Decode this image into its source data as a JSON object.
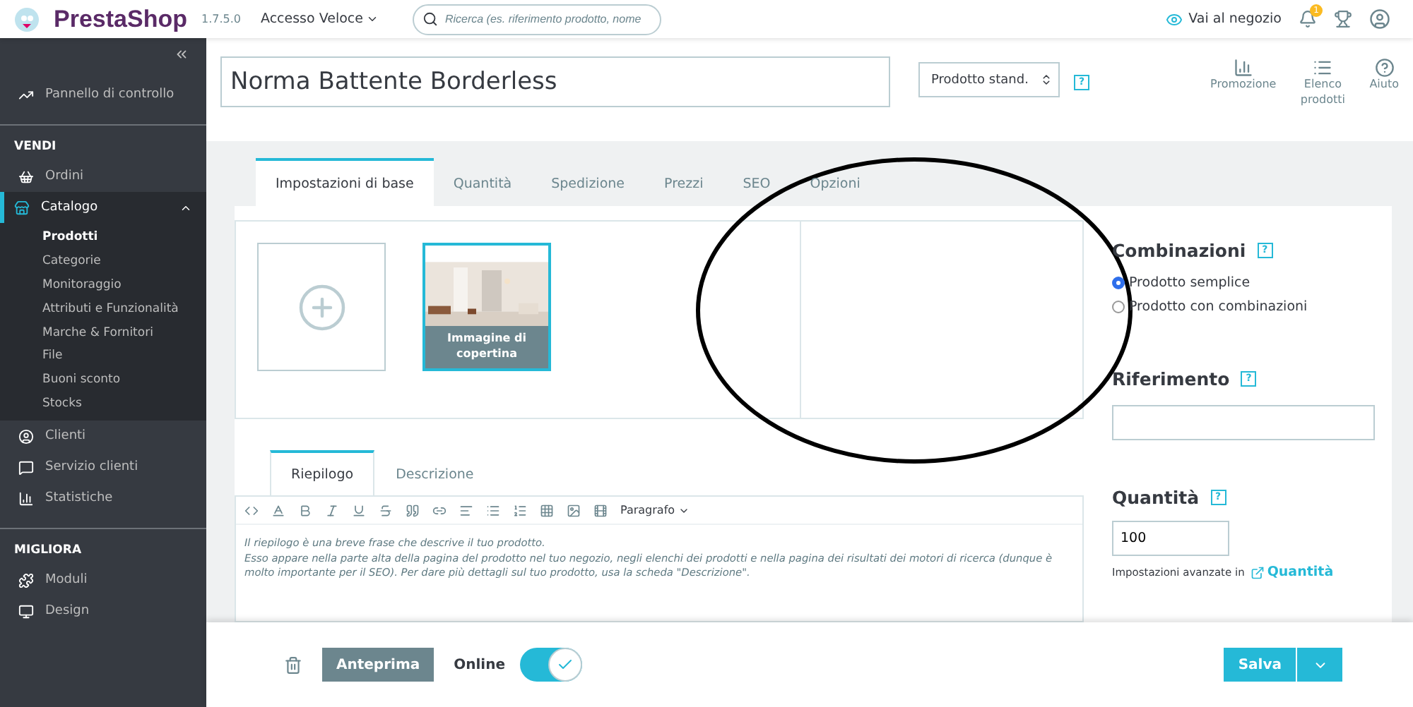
{
  "topbar": {
    "logo": "PrestaShop",
    "version": "1.7.5.0",
    "quick_access": "Accesso Veloce",
    "search": {
      "placeholder": "Ricerca (es. riferimento prodotto, nome"
    },
    "shop_link": "Vai al negozio",
    "notification_count": "1"
  },
  "sidebar": {
    "items": [
      {
        "kind": "link",
        "label": "Pannello di controllo",
        "selected": false
      },
      {
        "kind": "section",
        "label": "VENDI"
      },
      {
        "kind": "link",
        "label": "Ordini",
        "selected": false
      },
      {
        "kind": "link",
        "label": "Catalogo",
        "selected": true,
        "expanded": true,
        "children": [
          {
            "label": "Prodotti",
            "selected": true
          },
          {
            "label": "Categorie",
            "selected": false
          },
          {
            "label": "Monitoraggio",
            "selected": false
          },
          {
            "label": "Attributi e Funzionalità",
            "selected": false
          },
          {
            "label": "Marche & Fornitori",
            "selected": false
          },
          {
            "label": "File",
            "selected": false
          },
          {
            "label": "Buoni sconto",
            "selected": false
          },
          {
            "label": "Stocks",
            "selected": false
          }
        ]
      },
      {
        "kind": "link",
        "label": "Clienti",
        "selected": false
      },
      {
        "kind": "link",
        "label": "Servizio clienti",
        "selected": false
      },
      {
        "kind": "link",
        "label": "Statistiche",
        "selected": false
      },
      {
        "kind": "section",
        "label": "MIGLIORA"
      },
      {
        "kind": "link",
        "label": "Moduli",
        "selected": false
      },
      {
        "kind": "link",
        "label": "Design",
        "selected": false
      }
    ]
  },
  "header": {
    "product_name": "Norma Battente Borderless",
    "product_type": "Prodotto stand.",
    "help": "?",
    "actions": [
      {
        "label": "Promozione"
      },
      {
        "label": "Elenco prodotti"
      },
      {
        "label": "Aiuto"
      }
    ]
  },
  "tabs": [
    {
      "label": "Impostazioni di base",
      "selected": true
    },
    {
      "label": "Quantità",
      "selected": false
    },
    {
      "label": "Spedizione",
      "selected": false
    },
    {
      "label": "Prezzi",
      "selected": false
    },
    {
      "label": "SEO",
      "selected": false
    },
    {
      "label": "Opzioni",
      "selected": false
    }
  ],
  "images": {
    "cover_label": "Immagine di copertina"
  },
  "editor": {
    "tabs": [
      {
        "label": "Riepilogo",
        "selected": true
      },
      {
        "label": "Descrizione",
        "selected": false
      }
    ],
    "format": "Paragrafo",
    "paragraphs": [
      "Il riepilogo è una breve frase che descrive il tuo prodotto.",
      "Esso appare nella parte alta della pagina del prodotto nel tuo negozio, negli elenchi dei prodotti e nella pagina dei risultati dei motori di ricerca (dunque è molto importante per il SEO). Per dare più dettagli sul tuo prodotto, usa la scheda \"Descrizione\"."
    ]
  },
  "combinations": {
    "title": "Combinazioni",
    "help": "?",
    "options": [
      {
        "label": "Prodotto semplice",
        "selected": true
      },
      {
        "label": "Prodotto con combinazioni",
        "selected": false
      }
    ]
  },
  "reference": {
    "title": "Riferimento",
    "help": "?"
  },
  "quantity": {
    "title": "Quantità",
    "help": "?",
    "value": "100",
    "advanced_text": "Impostazioni avanzate in",
    "advanced_link": "Quantità"
  },
  "footer": {
    "preview": "Anteprima",
    "online_label": "Online",
    "online": true,
    "save": "Salva"
  },
  "annotations": [
    {
      "kind": "ellipse"
    }
  ]
}
